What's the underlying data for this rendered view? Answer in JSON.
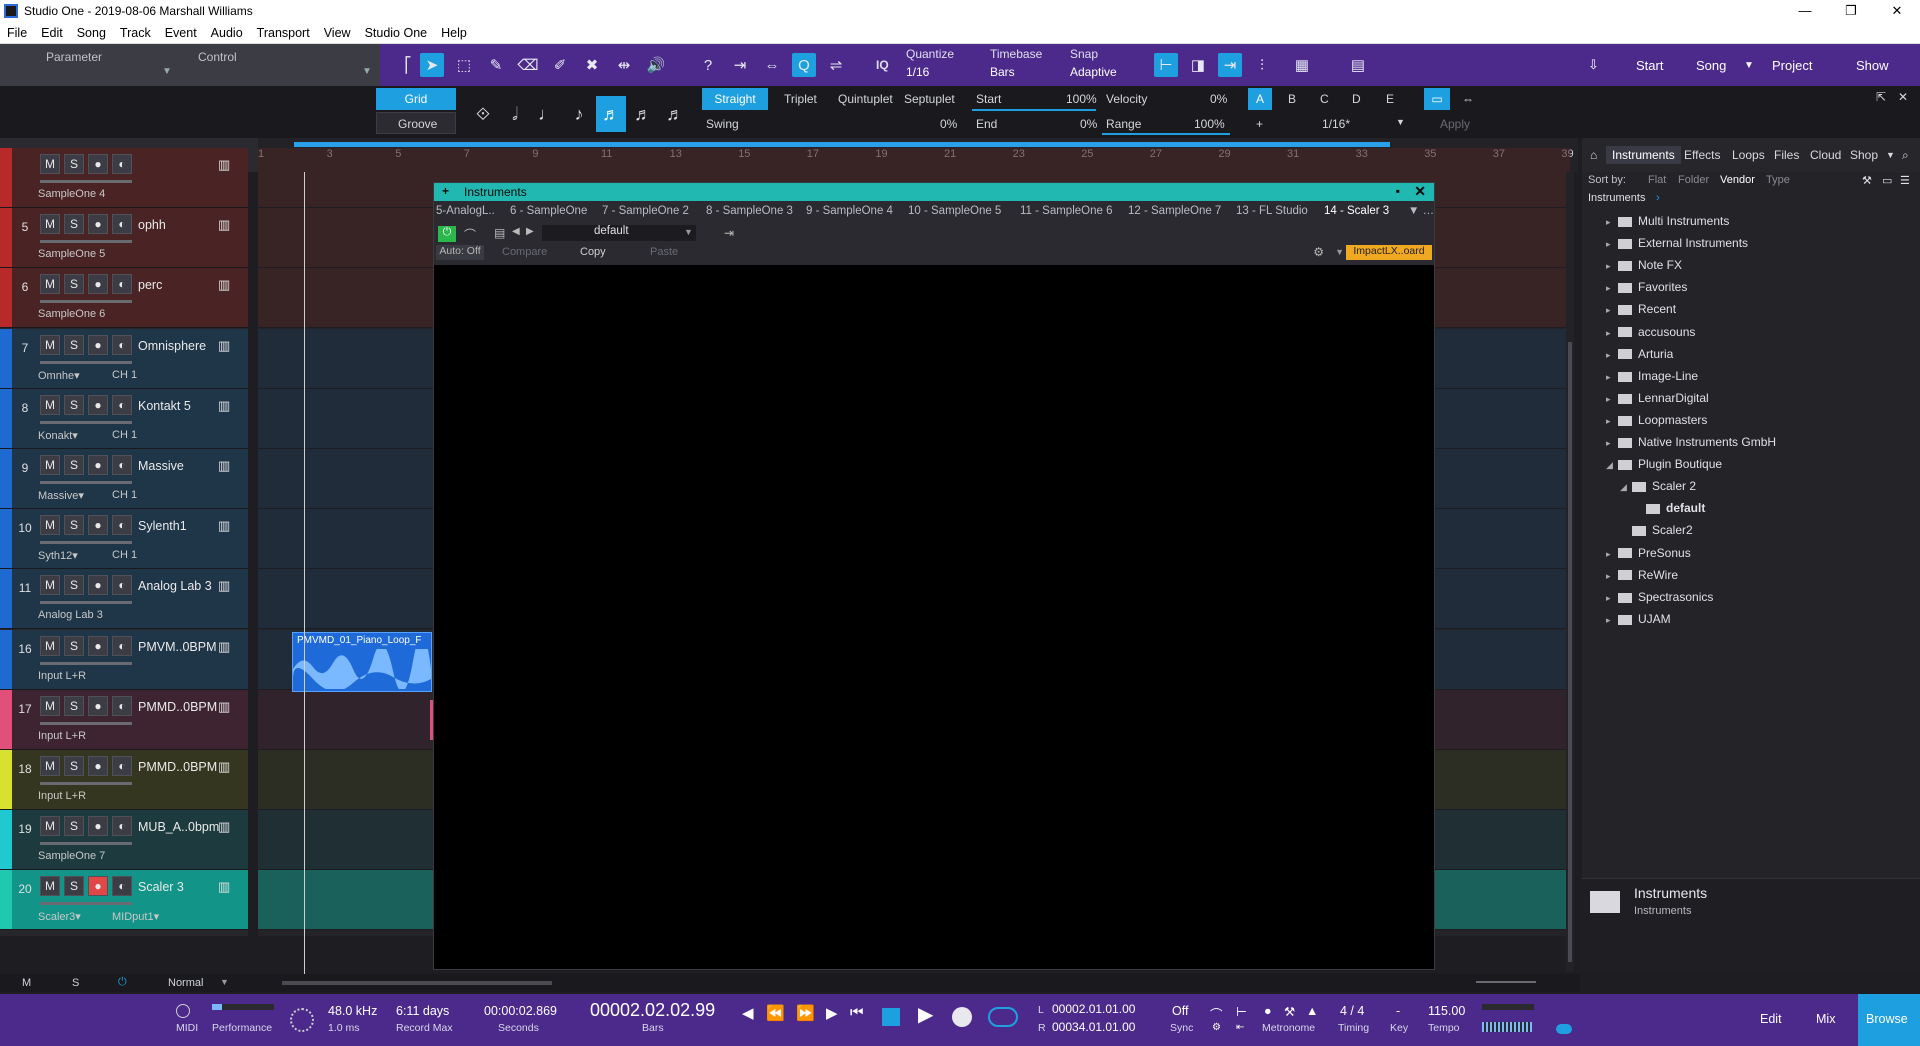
{
  "window": {
    "title": "Studio One - 2019-08-06 Marshall Williams",
    "minimize": "—",
    "maximize": "❐",
    "close": "✕"
  },
  "menu": [
    "File",
    "Edit",
    "Song",
    "Track",
    "Event",
    "Audio",
    "Transport",
    "View",
    "Studio One",
    "Help"
  ],
  "param_control": {
    "parameter": "Parameter",
    "control": "Control"
  },
  "toolbar": {
    "quantize_label": "Quantize",
    "quantize_value": "1/16",
    "timebase_label": "Timebase",
    "timebase_value": "Bars",
    "snap_label": "Snap",
    "snap_value": "Adaptive",
    "iq": "IQ",
    "start": "Start",
    "song": "Song",
    "project": "Project",
    "show": "Show"
  },
  "quantize_panel": {
    "grid": "Grid",
    "groove": "Groove",
    "straight": "Straight",
    "triplet": "Triplet",
    "quintuplet": "Quintuplet",
    "septuplet": "Septuplet",
    "swing_label": "Swing",
    "swing_value": "0%",
    "start_label": "Start",
    "start_value": "100%",
    "end_label": "End",
    "end_value": "0%",
    "velocity_label": "Velocity",
    "velocity_value": "0%",
    "range_label": "Range",
    "range_value": "100%",
    "slots": [
      "A",
      "B",
      "C",
      "D",
      "E"
    ],
    "plus": "+",
    "slot_value": "1/16*",
    "apply": "Apply"
  },
  "ruler": {
    "ticks": [
      "1",
      "3",
      "5",
      "7",
      "9",
      "11",
      "13",
      "15",
      "17",
      "19",
      "21",
      "23",
      "25",
      "27",
      "29",
      "31",
      "33",
      "35",
      "37",
      "39"
    ]
  },
  "tracks": [
    {
      "num": "",
      "name": "",
      "route": "SampleOne 4",
      "route2": "",
      "color": "#b82a2a",
      "bg": "#4a2424"
    },
    {
      "num": "5",
      "name": "ophh",
      "route": "SampleOne 5",
      "route2": "",
      "color": "#b82a2a",
      "bg": "#4a2424"
    },
    {
      "num": "6",
      "name": "perc",
      "route": "SampleOne 6",
      "route2": "",
      "color": "#b82a2a",
      "bg": "#4a2424"
    },
    {
      "num": "7",
      "name": "Omnisphere",
      "route": "Omnhe▾",
      "route2": "CH 1",
      "color": "#1e6ad0",
      "bg": "#1f3548"
    },
    {
      "num": "8",
      "name": "Kontakt 5",
      "route": "Konakt▾",
      "route2": "CH 1",
      "color": "#1e6ad0",
      "bg": "#1f3548"
    },
    {
      "num": "9",
      "name": "Massive",
      "route": "Massive▾",
      "route2": "CH 1",
      "color": "#1e6ad0",
      "bg": "#1f3548"
    },
    {
      "num": "10",
      "name": "Sylenth1",
      "route": "Syth12▾",
      "route2": "CH 1",
      "color": "#1e6ad0",
      "bg": "#1f3548"
    },
    {
      "num": "11",
      "name": "Analog Lab 3",
      "route": "Analog Lab 3",
      "route2": "",
      "color": "#1e6ad0",
      "bg": "#1f3548"
    },
    {
      "num": "16",
      "name": "PMVM..0BPM",
      "route": "Input L+R",
      "route2": "",
      "color": "#1e6ad0",
      "bg": "#1f3548"
    },
    {
      "num": "17",
      "name": "PMMD..0BPM",
      "route": "Input L+R",
      "route2": "",
      "color": "#e0507a",
      "bg": "#3e2430"
    },
    {
      "num": "18",
      "name": "PMMD..0BPM",
      "route": "Input L+R",
      "route2": "",
      "color": "#d8e030",
      "bg": "#35361f"
    },
    {
      "num": "19",
      "name": "MUB_A..0bpm",
      "route": "SampleOne 7",
      "route2": "",
      "color": "#20c8d0",
      "bg": "#1d3a3e"
    },
    {
      "num": "20",
      "name": "Scaler 3",
      "route": "Scaler3▾",
      "route2": "MIDput1▾",
      "color": "#20c8b0",
      "bg": "#139488"
    }
  ],
  "track_buttons": {
    "m": "M",
    "s": "S",
    "rec": "●",
    "mon": "◐"
  },
  "clip": {
    "name": "PMVMD_01_Piano_Loop_F"
  },
  "instruments_window": {
    "title": "Instruments",
    "tabs": [
      "5-AnalogL..",
      "6 - SampleOne",
      "7 - SampleOne 2",
      "8 - SampleOne 3",
      "9 - SampleOne 4",
      "10 - SampleOne 5",
      "11 - SampleOne 6",
      "12 - SampleOne 7",
      "13 - FL Studio",
      "14 - Scaler 3"
    ],
    "preset": "default",
    "auto_off": "Auto: Off",
    "compare": "Compare",
    "copy": "Copy",
    "paste": "Paste",
    "device": "ImpactLX..oard"
  },
  "browser": {
    "tabs": [
      "Instruments",
      "Effects",
      "Loops",
      "Files",
      "Cloud",
      "Shop"
    ],
    "sort_by": "Sort by:",
    "sort_opts": [
      "Flat",
      "Folder",
      "Vendor",
      "Type"
    ],
    "breadcrumb": "Instruments",
    "items": [
      {
        "label": "Multi Instruments",
        "indent": 0,
        "caret": "▸"
      },
      {
        "label": "External Instruments",
        "indent": 0,
        "caret": "▸"
      },
      {
        "label": "Note FX",
        "indent": 0,
        "caret": "▸"
      },
      {
        "label": "Favorites",
        "indent": 0,
        "caret": "▸"
      },
      {
        "label": "Recent",
        "indent": 0,
        "caret": "▸"
      },
      {
        "label": "accusouns",
        "indent": 0,
        "caret": "▸"
      },
      {
        "label": "Arturia",
        "indent": 0,
        "caret": "▸"
      },
      {
        "label": "Image-Line",
        "indent": 0,
        "caret": "▸"
      },
      {
        "label": "LennarDigital",
        "indent": 0,
        "caret": "▸"
      },
      {
        "label": "Loopmasters",
        "indent": 0,
        "caret": "▸"
      },
      {
        "label": "Native Instruments GmbH",
        "indent": 0,
        "caret": "▸"
      },
      {
        "label": "Plugin Boutique",
        "indent": 0,
        "caret": "◢"
      },
      {
        "label": "Scaler 2",
        "indent": 1,
        "caret": "◢"
      },
      {
        "label": "default",
        "indent": 2,
        "caret": ""
      },
      {
        "label": "Scaler2",
        "indent": 1,
        "caret": ""
      },
      {
        "label": "PreSonus",
        "indent": 0,
        "caret": "▸"
      },
      {
        "label": "ReWire",
        "indent": 0,
        "caret": "▸"
      },
      {
        "label": "Spectrasonics",
        "indent": 0,
        "caret": "▸"
      },
      {
        "label": "UJAM",
        "indent": 0,
        "caret": "▸"
      }
    ],
    "footer_title": "Instruments",
    "footer_sub": "Instruments"
  },
  "bottom_strip": {
    "m": "M",
    "s": "S",
    "mode": "Normal"
  },
  "transport": {
    "midi": "MIDI",
    "performance": "Performance",
    "sample_rate": "48.0 kHz",
    "latency": "1.0 ms",
    "record_max_val": "6:11 days",
    "record_max": "Record Max",
    "seconds_val": "00:00:02.869",
    "seconds": "Seconds",
    "bars_val": "00002.02.02.99",
    "bars": "Bars",
    "loop_l": "00002.01.01.00",
    "loop_r": "00034.01.01.00",
    "l": "L",
    "r": "R",
    "sync_val": "Off",
    "sync": "Sync",
    "metronome": "Metronome",
    "timing_val": "4 / 4",
    "timing": "Timing",
    "key_val": "-",
    "key": "Key",
    "tempo_val": "115.00",
    "tempo": "Tempo",
    "edit": "Edit",
    "mix": "Mix",
    "browse": "Browse"
  }
}
